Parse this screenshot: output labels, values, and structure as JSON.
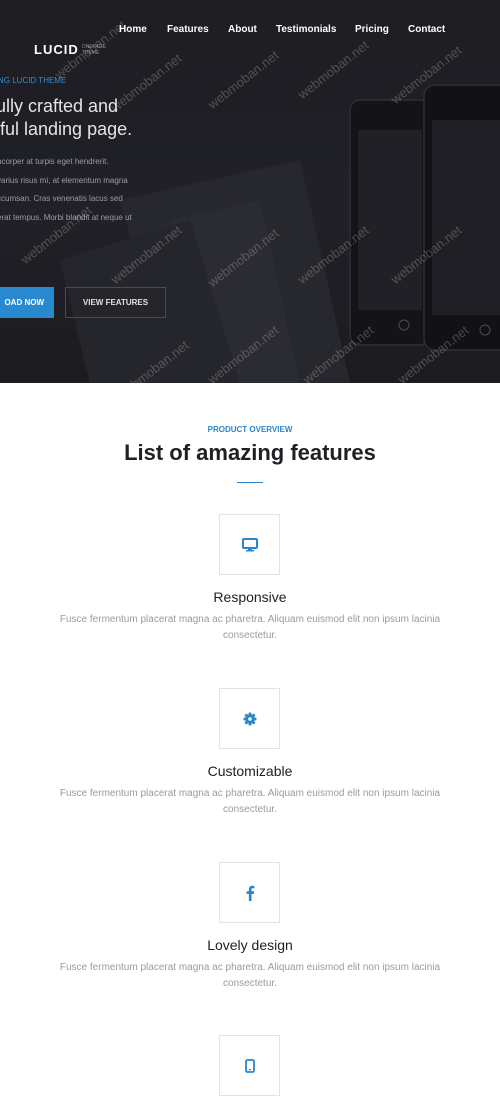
{
  "brand": {
    "name": "LUCID",
    "tagline": "ONEPAGE THEME"
  },
  "nav": {
    "items": [
      {
        "label": "Home"
      },
      {
        "label": "Features"
      },
      {
        "label": "About"
      },
      {
        "label": "Testimonials"
      },
      {
        "label": "Pricing"
      },
      {
        "label": "Contact"
      }
    ]
  },
  "hero": {
    "kicker": "NG LUCID THEME",
    "title_line1": "ully crafted and",
    "title_line2": "iful landing page.",
    "body_line1": "ncorper at turpis eget hendrerit.",
    "body_line2": "varius risus mi, at elementum magna",
    "body_line3": "ccumsan. Cras venenatis lacus sed",
    "body_line4": "erat tempus. Morbi blandit at neque ut",
    "primary_button": "OAD NOW",
    "secondary_button": "VIEW FEATURES"
  },
  "watermark_text": "webmoban.net",
  "features": {
    "kicker": "PRODUCT OVERVIEW",
    "title": "List of amazing features",
    "items": [
      {
        "icon": "monitor-icon",
        "title": "Responsive",
        "desc_line1": "Fusce fermentum placerat magna ac pharetra. Aliquam euismod elit non ipsum lacinia",
        "desc_line2": "consectetur."
      },
      {
        "icon": "gear-icon",
        "title": "Customizable",
        "desc_line1": "Fusce fermentum placerat magna ac pharetra. Aliquam euismod elit non ipsum lacinia",
        "desc_line2": "consectetur."
      },
      {
        "icon": "facebook-icon",
        "title": "Lovely design",
        "desc_line1": "Fusce fermentum placerat magna ac pharetra. Aliquam euismod elit non ipsum lacinia",
        "desc_line2": "consectetur."
      },
      {
        "icon": "mobile-icon"
      }
    ]
  },
  "colors": {
    "accent": "#2a86cc",
    "hero_bg": "#1f1f25",
    "text_dark": "#1f1f24",
    "text_muted": "#9a9aa2"
  }
}
